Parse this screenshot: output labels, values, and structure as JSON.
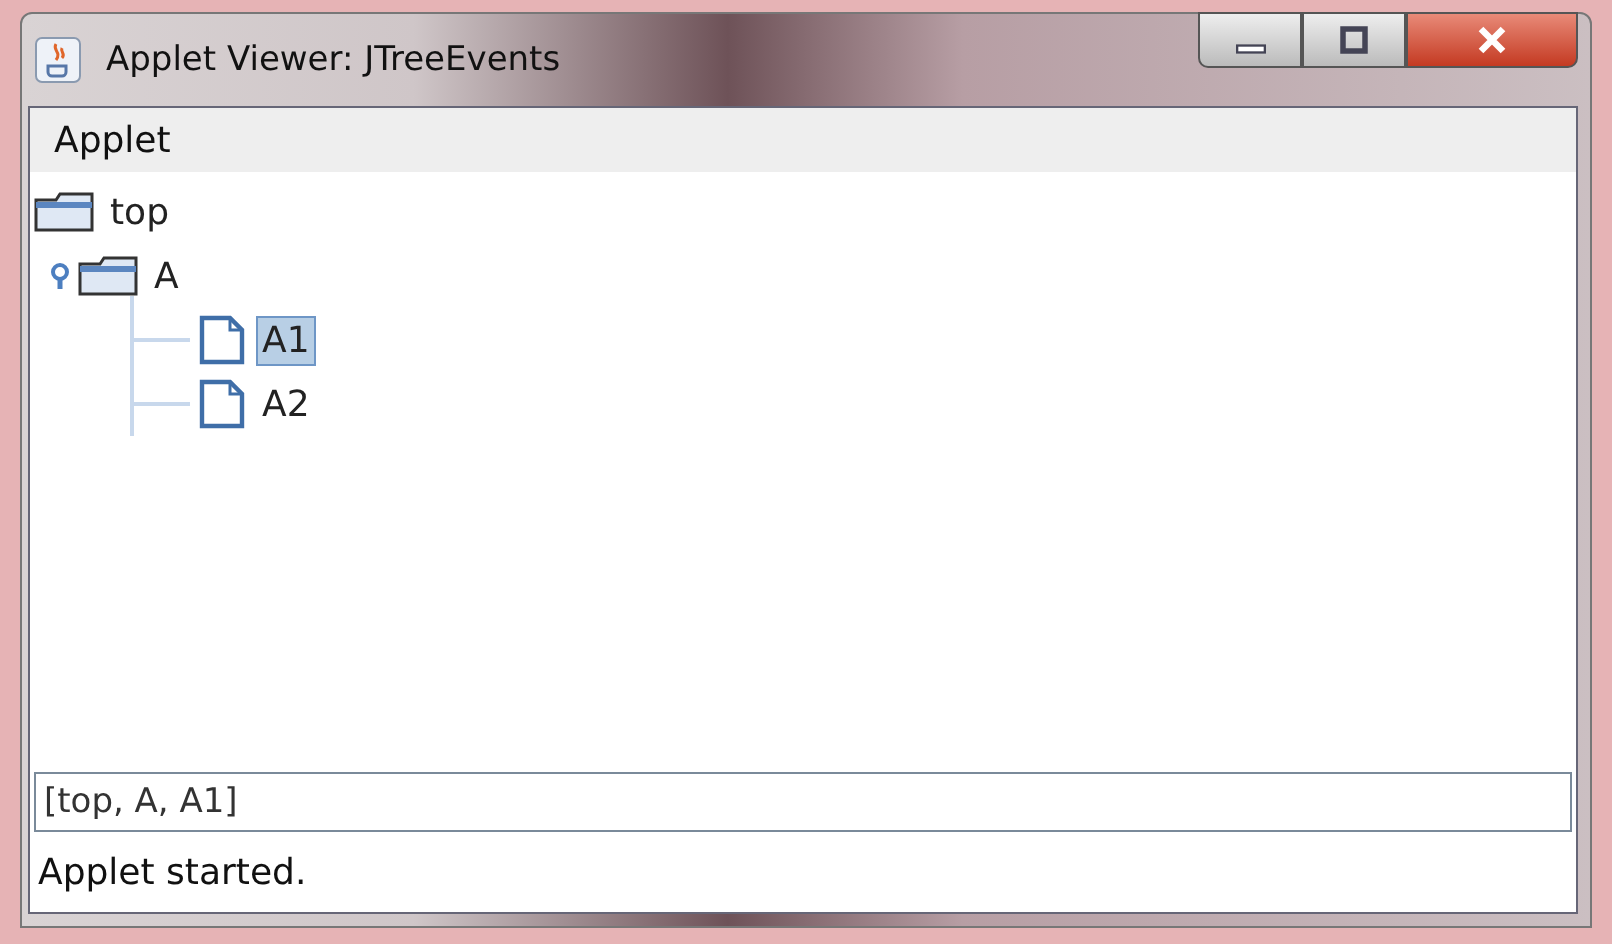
{
  "window": {
    "title": "Applet Viewer: JTreeEvents"
  },
  "menu": [
    {
      "label": "Applet"
    }
  ],
  "tree": {
    "label": "top",
    "kind": "folder",
    "selected": false,
    "children": [
      {
        "label": "A",
        "kind": "folder",
        "selected": false,
        "expanded": true,
        "children": [
          {
            "label": "A1",
            "kind": "leaf",
            "selected": true
          },
          {
            "label": "A2",
            "kind": "leaf",
            "selected": false
          }
        ]
      }
    ]
  },
  "path_field": {
    "value": "[top, A, A1]"
  },
  "status_bar": "Applet started."
}
